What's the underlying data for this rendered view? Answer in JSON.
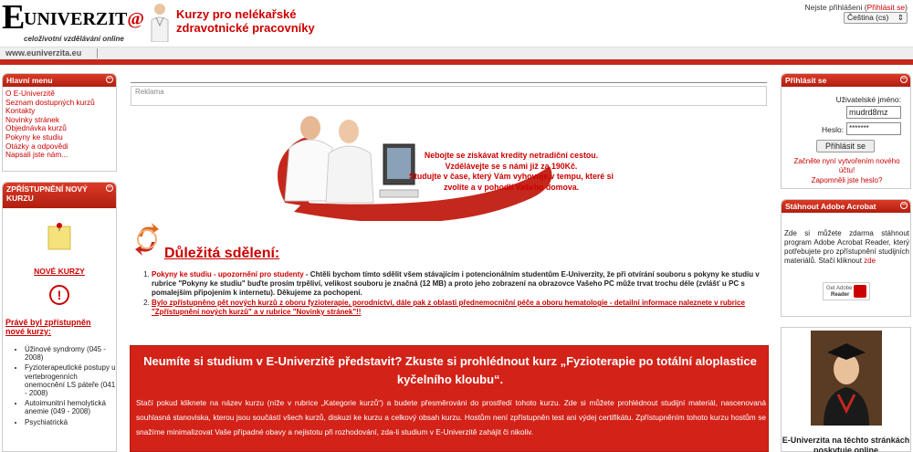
{
  "header": {
    "logo_letter": "E",
    "logo_word": "UNIVERZIT",
    "logo_at": "@",
    "logo_sub": "celoživotní vzdělávání online",
    "tagline_1": "Kurzy pro nelékařské",
    "tagline_2": "zdravotnické pracovníky",
    "login_status": "Nejste přihlášeni (",
    "login_link": "Přihlásit se",
    "login_status_end": ")",
    "language": "Čeština (cs)",
    "url": "www.euniverzita.eu"
  },
  "menu": {
    "title": "Hlavní menu",
    "items": [
      {
        "label": "O E-Univerzitě"
      },
      {
        "label": "Seznam dostupných kurzů"
      },
      {
        "label": "Kontakty"
      },
      {
        "label": "Novinky stránek"
      },
      {
        "label": "Objednávka kurzů"
      },
      {
        "label": "Pokyny ke studiu"
      },
      {
        "label": "Otázky a odpovědi"
      },
      {
        "label": "Napsali jste nám..."
      }
    ]
  },
  "new_course": {
    "title": "ZPŘÍSTUPNĚNÍ NOVÝ KURZU",
    "link": "NOVÉ KURZY",
    "just_label": "Právě byl zpřístupněn nové kurzy:",
    "courses": [
      "Úžinové syndromy (045 - 2008)",
      "Fyzioterapeutické postupy u vertebrogenních onemocnění LS páteře (041 - 2008)",
      "Autoimunitní hemolytická anemie (049 - 2008)",
      "Psychiatrická"
    ]
  },
  "center": {
    "reklama": "Reklama",
    "banner_lines": [
      "Nebojte se získávat kredity netradiční cestou.",
      "Vzdělávejte se s námi již za 190Kč.",
      "Studujte v čase, který Vám vyhovuje,v tempu, které si",
      "zvolíte a v pohodlí Vašeho domova."
    ],
    "info_title": "Důležitá sdělení:",
    "notice_1_red": "Pokyny ke studiu - upozornění pro studenty",
    "notice_1_text": " - Chtěli bychom tímto sdělit všem stávajícím i potencionálním studentům E-Univerzity, že při otvírání souboru s pokyny ke studiu v rubrice \"Pokyny ke studiu\" buďte prosím trpěliví, velikost souboru je značná (12 MB) a proto jeho zobrazení na obrazovce Vašeho PC může trvat trochu déle (zvlášť u PC s pomalejším připojením k internetu). Děkujeme za pochopení.",
    "notice_2": "Bylo zpřístupněno pět nových kurzů z oboru fyzioterapie, porodnictví, dále pak z oblasti přednemocniční péče a oboru hematologie - detailní informace naleznete v rubrice \"Zpřístupnění nových kurzů\" a v rubrice \"Novinky stránek\"!!",
    "promo_title": "Neumíte si studium v E-Univerzitě představit? Zkuste si prohlédnout kurz „Fyzioterapie po totální aloplastice kyčelního kloubu“.",
    "promo_body": "Stačí pokud kliknete na název kurzu (níže v rubrice „Kategorie kurzů“) a budete přesměrováni do prostředí tohoto kurzu. Zde si můžete prohlédnout studijní materiál, nascenovaná souhlasná stanoviska, kterou jsou součástí všech kurzů, diskuzi ke kurzu a celkový obsah kurzu. Hostům není zpřístupněn test ani výdej certifikátu. Zpřístupněním tohoto kurzu hostům se snažíme minimalizovat Vaše případné obavy a nejistotu při rozhodování, zda-li studium v E-Univerzitě zahájit či nikoliv."
  },
  "login": {
    "title": "Přihlásit se",
    "user_label": "Uživatelské jméno:",
    "user_value": "mudrd8mz",
    "pass_label": "Heslo:",
    "pass_value": "*******",
    "button": "Přihlásit se",
    "create": "Začněte nyní vytvořením nového účtu!",
    "forgot": "Zapomněli jste heslo?"
  },
  "acrobat": {
    "title": "Stáhnout Adobe Acrobat",
    "text": "Zde si můžete zdarma stáhnout program Adobe Acrobat Reader, který potřebujete pro zpřístupnění studijních materiálů. Stačí kliknout ",
    "link": "zde",
    "badge_1": "Get Adobe",
    "badge_2": "Reader"
  },
  "grad": {
    "text": "E-Univerzita na těchto stránkách poskytuje online"
  },
  "colors": {
    "accent": "#c4281c",
    "link": "#cc0000"
  }
}
